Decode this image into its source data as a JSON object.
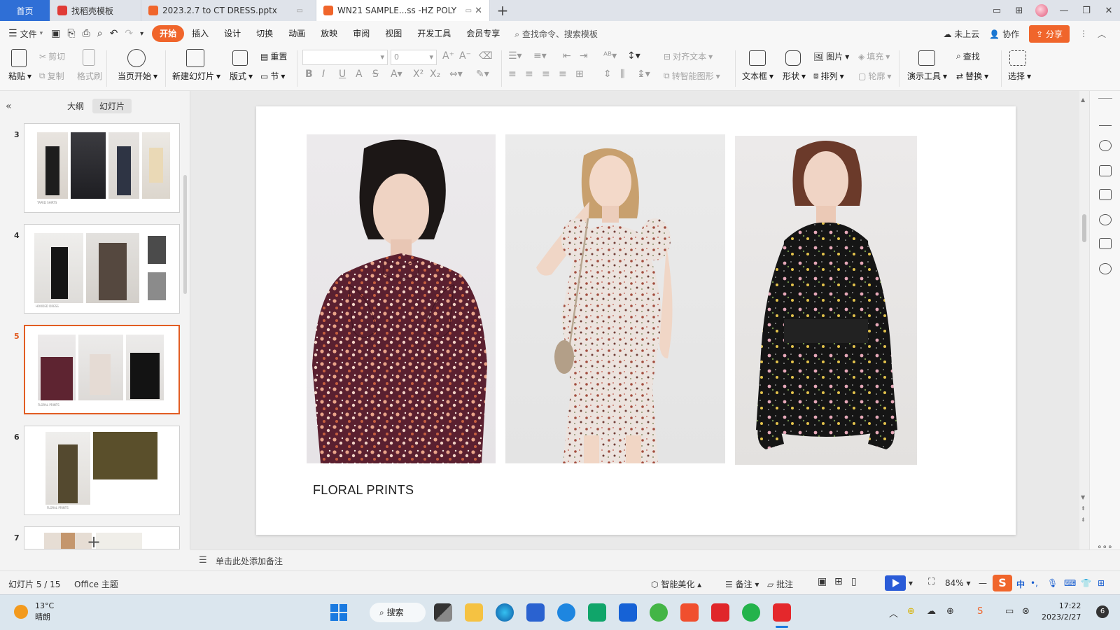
{
  "titlebar": {
    "tabs": [
      {
        "label": "首页",
        "color": "#2f6fd6"
      },
      {
        "label": "找稻壳模板",
        "color": "#e03b36"
      },
      {
        "label": "2023.2.7 to CT DRESS.pptx",
        "color": "#f0652b"
      },
      {
        "label": "WN21 SAMPLE...ss -HZ POLY",
        "color": "#f0652b"
      }
    ],
    "new_tab": "+",
    "window_controls": [
      "—",
      "❐",
      "✕"
    ]
  },
  "menubar": {
    "file_label": "文件",
    "items": [
      "开始",
      "插入",
      "设计",
      "切换",
      "动画",
      "放映",
      "审阅",
      "视图",
      "开发工具",
      "会员专享"
    ],
    "active_item": "开始",
    "search": "查找命令、搜索模板",
    "cloud": "未上云",
    "collab": "协作",
    "share": "分享"
  },
  "ribbon": {
    "paste": "粘贴",
    "cut": "剪切",
    "copy": "复制",
    "format_painter": "格式刷",
    "from_current": "当页开始",
    "new_slide": "新建幻灯片",
    "layout": "版式",
    "reset": "重置",
    "section": "节",
    "font_size_value": "0",
    "align_text": "对齐文本",
    "smartart": "转智能图形",
    "textbox": "文本框",
    "shape": "形状",
    "picture": "图片",
    "arrange": "排列",
    "fill": "填充",
    "outline": "轮廓",
    "present_tools": "演示工具",
    "find": "查找",
    "replace": "替换",
    "select": "选择"
  },
  "leftpanel": {
    "tab_outline": "大纲",
    "tab_slides": "幻灯片",
    "active_tab": "幻灯片",
    "slides": [
      {
        "num": "3",
        "caption": "TAPED SHIRTS"
      },
      {
        "num": "4",
        "caption": "HOODED DRESS"
      },
      {
        "num": "5",
        "caption": "FLORAL PRINTS",
        "active": true
      },
      {
        "num": "6",
        "caption": "FLORAL PRINTS"
      },
      {
        "num": "7",
        "caption": ""
      }
    ],
    "add_slide": "+"
  },
  "slide": {
    "title": "FLORAL PRINTS"
  },
  "notes": {
    "placeholder": "单击此处添加备注"
  },
  "statusbar": {
    "slide_info": "幻灯片 5 / 15",
    "theme": "Office 主题",
    "beautify": "智能美化",
    "notes": "备注",
    "comments": "批注",
    "zoom": "84%",
    "ime": "中"
  },
  "taskbar": {
    "temperature": "13°C",
    "weather": "晴朗",
    "search": "搜索",
    "time": "17:22",
    "date": "2023/2/27",
    "notifications": "6"
  }
}
